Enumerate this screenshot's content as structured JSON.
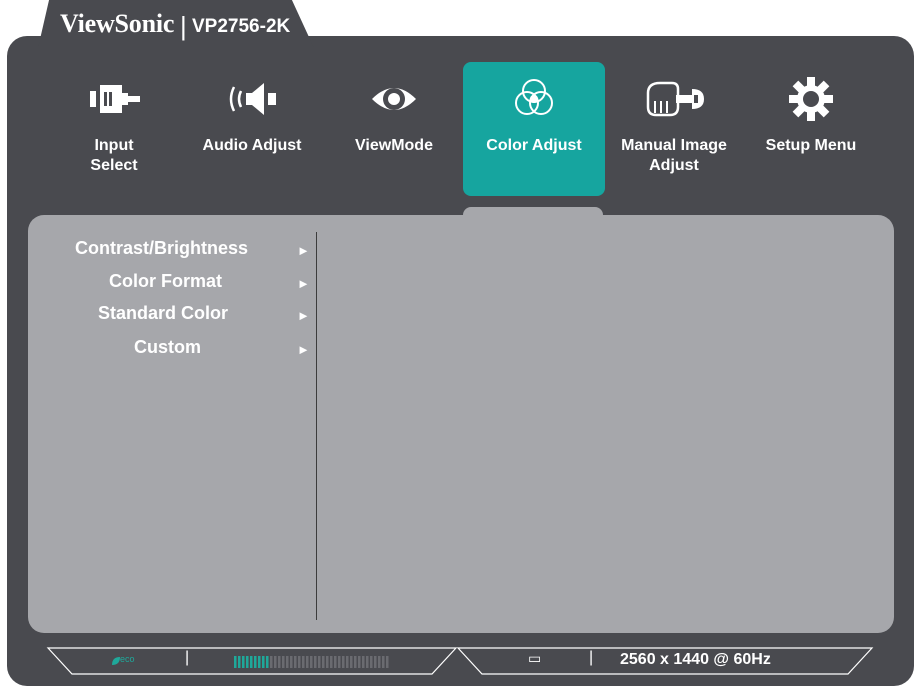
{
  "header": {
    "brand": "ViewSonic",
    "separator": "|",
    "model": "VP2756-2K"
  },
  "tabs": [
    {
      "label_line1": "Input",
      "label_line2": "Select",
      "icon": "input-select-icon"
    },
    {
      "label_line1": "Audio Adjust",
      "label_line2": "",
      "icon": "speaker-icon"
    },
    {
      "label_line1": "ViewMode",
      "label_line2": "",
      "icon": "eye-icon"
    },
    {
      "label_line1": "Color Adjust",
      "label_line2": "",
      "icon": "color-circles-icon",
      "active": true
    },
    {
      "label_line1": "Manual Image",
      "label_line2": "Adjust",
      "icon": "hand-wrench-icon"
    },
    {
      "label_line1": "Setup Menu",
      "label_line2": "",
      "icon": "gear-icon"
    }
  ],
  "submenu": [
    {
      "label": "Contrast/Brightness",
      "arrow": "►"
    },
    {
      "label": "Color Format",
      "arrow": "►"
    },
    {
      "label": "Standard Color",
      "arrow": "►"
    },
    {
      "label": "Custom",
      "arrow": "►"
    }
  ],
  "status": {
    "eco_label": "eco",
    "separator": "|",
    "signal_label": "▭",
    "resolution": "2560 x 1440 @ 60Hz",
    "level_fraction": 0.22
  },
  "colors": {
    "frame": "#494a4f",
    "panel": "#a6a7ab",
    "active_tab": "#16a59f",
    "eco": "#1fa89a"
  }
}
